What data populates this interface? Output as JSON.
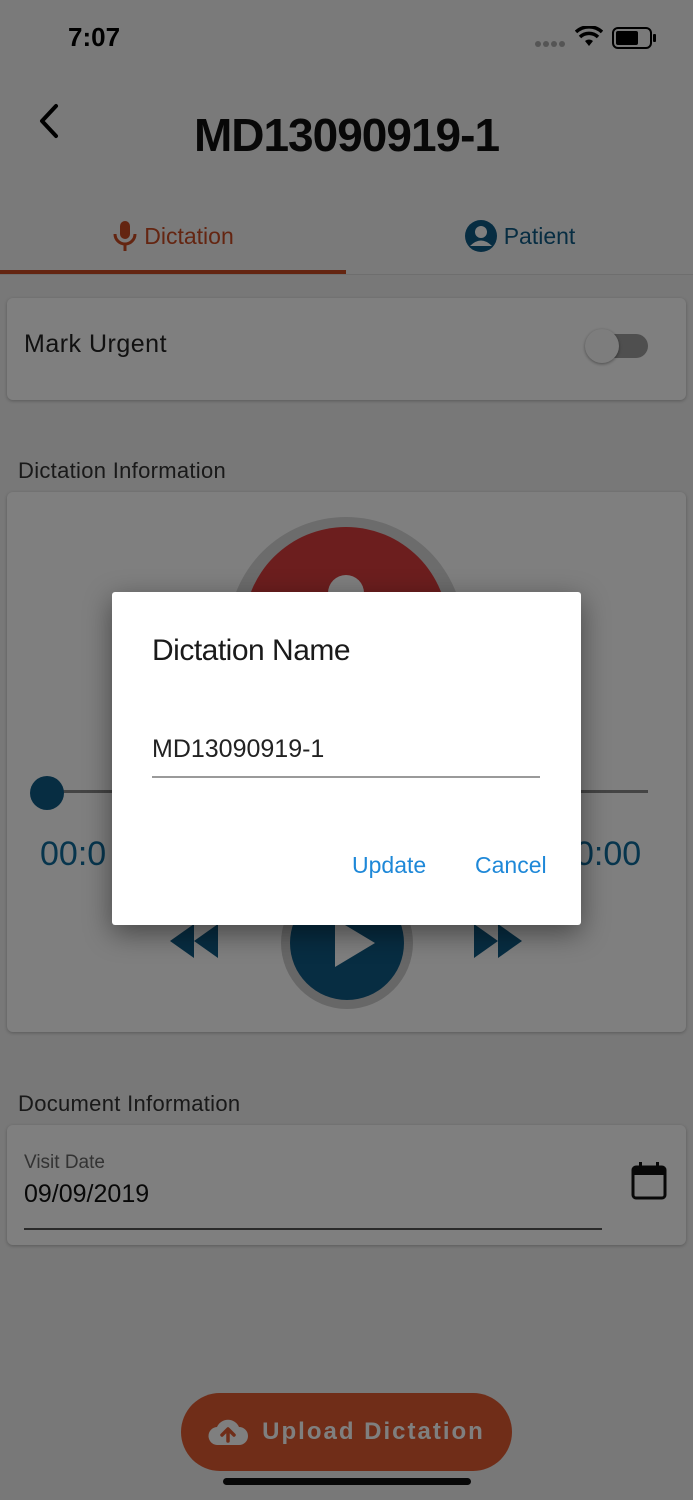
{
  "status_bar": {
    "time": "7:07"
  },
  "header": {
    "title": "MD13090919-1"
  },
  "tabs": [
    {
      "label": "Dictation",
      "icon": "microphone-icon",
      "active": true
    },
    {
      "label": "Patient",
      "icon": "account-circle-icon",
      "active": false
    }
  ],
  "urgent": {
    "label": "Mark Urgent",
    "enabled": false
  },
  "dictation_info": {
    "section_label": "Dictation Information",
    "elapsed": "00:0",
    "total": "0:00"
  },
  "document_info": {
    "section_label": "Document Information",
    "visit_date_label": "Visit Date",
    "visit_date_value": "09/09/2019"
  },
  "upload_button": {
    "label": "Upload Dictation"
  },
  "dialog": {
    "title": "Dictation Name",
    "input_value": "MD13090919-1",
    "update_label": "Update",
    "cancel_label": "Cancel"
  },
  "colors": {
    "accent": "#c84a22",
    "primary": "#0e5a85",
    "record": "#d83c3c",
    "upload": "#e05a30",
    "dialog_action": "#1e88d8"
  }
}
